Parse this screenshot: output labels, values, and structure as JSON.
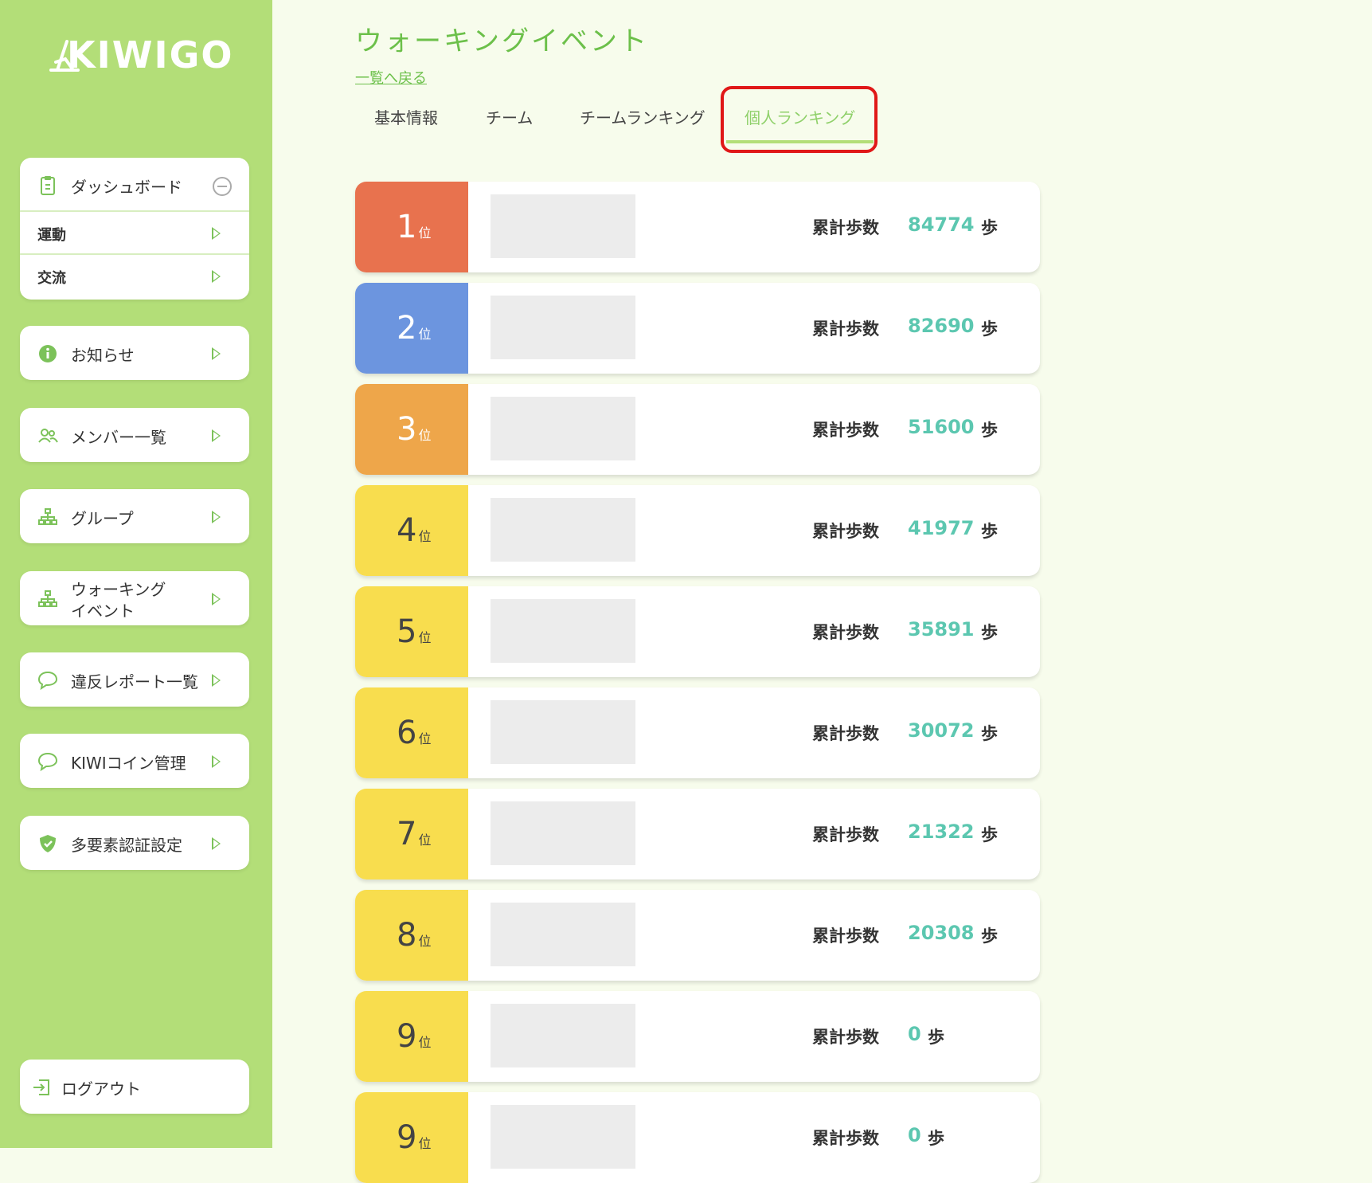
{
  "brand": {
    "logo_text": "KIWIGO"
  },
  "sidebar": {
    "dashboard": {
      "label": "ダッシュボード",
      "subitems": [
        "運動",
        "交流"
      ]
    },
    "items": [
      {
        "label": "お知らせ",
        "icon": "info-icon"
      },
      {
        "label": "メンバー一覧",
        "icon": "members-icon"
      },
      {
        "label": "グループ",
        "icon": "group-icon"
      },
      {
        "label": "ウォーキングイベント",
        "line1": "ウォーキング",
        "line2": "イベント",
        "icon": "group-icon"
      },
      {
        "label": "違反レポート一覧",
        "icon": "speech-bubble-icon"
      },
      {
        "label": "KIWIコイン管理",
        "icon": "speech-bubble-icon"
      },
      {
        "label": "多要素認証設定",
        "icon": "shield-icon"
      }
    ],
    "logout": {
      "label": "ログアウト",
      "icon": "logout-icon"
    }
  },
  "header": {
    "title": "ウォーキングイベント",
    "back_link": "一覧へ戻る"
  },
  "tabs": [
    {
      "label": "基本情報",
      "active": false
    },
    {
      "label": "チーム",
      "active": false
    },
    {
      "label": "チームランキング",
      "active": false
    },
    {
      "label": "個人ランキング",
      "active": true
    }
  ],
  "ranking": {
    "steps_label": "累計歩数",
    "unit": "歩",
    "rank_suffix": "位",
    "rows": [
      {
        "rank": "1",
        "steps": "84774",
        "color": "#e8724e"
      },
      {
        "rank": "2",
        "steps": "82690",
        "color": "#6c95df"
      },
      {
        "rank": "3",
        "steps": "51600",
        "color": "#eea64a"
      },
      {
        "rank": "4",
        "steps": "41977",
        "color": "#f8dd4e"
      },
      {
        "rank": "5",
        "steps": "35891",
        "color": "#f8dd4e"
      },
      {
        "rank": "6",
        "steps": "30072",
        "color": "#f8dd4e"
      },
      {
        "rank": "7",
        "steps": "21322",
        "color": "#f8dd4e"
      },
      {
        "rank": "8",
        "steps": "20308",
        "color": "#f8dd4e"
      },
      {
        "rank": "9",
        "steps": "0",
        "color": "#f8dd4e"
      },
      {
        "rank": "9",
        "steps": "0",
        "color": "#f8dd4e"
      }
    ]
  },
  "colors": {
    "accent": "#6cc04a",
    "sidebar_bg": "#b3de78",
    "steps_value": "#5cc7b0",
    "highlight": "#e01818"
  }
}
